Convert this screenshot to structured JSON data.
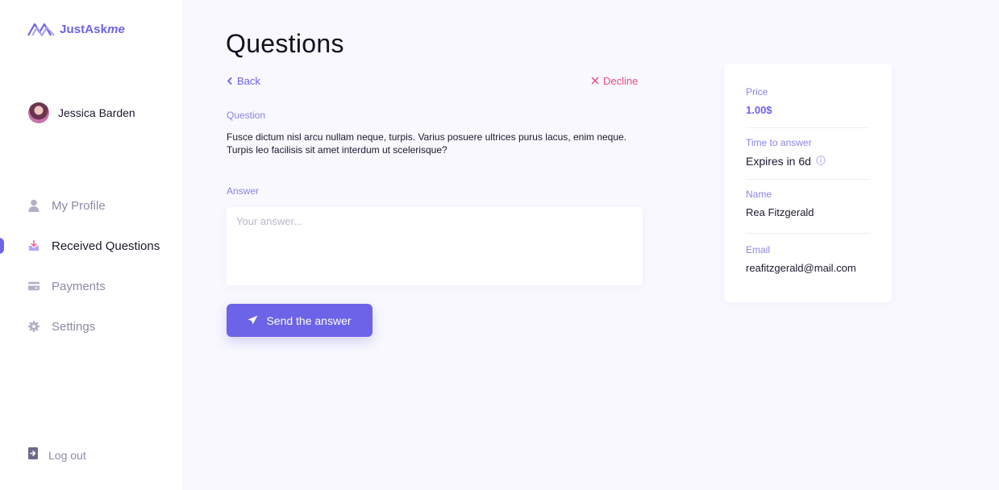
{
  "app": {
    "logo_main": "JustAsk",
    "logo_italic": "me"
  },
  "user": {
    "name": "Jessica Barden"
  },
  "nav": {
    "items": [
      {
        "label": "My Profile",
        "icon": "user-icon",
        "active": false
      },
      {
        "label": "Received Questions",
        "icon": "inbox-download-icon",
        "active": true
      },
      {
        "label": "Payments",
        "icon": "credit-card-icon",
        "active": false
      },
      {
        "label": "Settings",
        "icon": "gear-icon",
        "active": false
      }
    ],
    "logout_label": "Log out"
  },
  "main": {
    "title": "Questions",
    "back_label": "Back",
    "decline_label": "Decline",
    "question_label": "Question",
    "question_text": "Fusce dictum nisl arcu nullam neque, turpis. Varius posuere ultrices purus lacus, enim neque. Turpis leo facilisis sit amet interdum ut scelerisque?",
    "answer_label": "Answer",
    "answer_placeholder": "Your answer...",
    "answer_value": "",
    "send_label": "Send the answer"
  },
  "info": {
    "price_label": "Price",
    "price_value": "1.00$",
    "time_label": "Time to answer",
    "time_value": "Expires in 6d",
    "name_label": "Name",
    "name_value": "Rea Fitzgerald",
    "email_label": "Email",
    "email_value": "reafitzgerald@mail.com"
  },
  "colors": {
    "accent": "#6c63e8",
    "decline": "#ec4b8a",
    "label": "#8a84e6",
    "muted": "#8e8aa6",
    "background": "#f8f8fe"
  }
}
